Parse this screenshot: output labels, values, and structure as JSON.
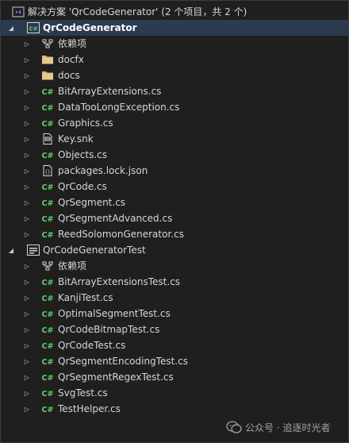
{
  "solution": {
    "label": "解决方案 'QrCodeGenerator' (2 个项目，共 2 个)"
  },
  "projects": [
    {
      "label": "QrCodeGenerator",
      "items": [
        {
          "label": "依赖项",
          "icon": "dependencies-icon"
        },
        {
          "label": "docfx",
          "icon": "folder-icon"
        },
        {
          "label": "docs",
          "icon": "folder-icon"
        },
        {
          "label": "BitArrayExtensions.cs",
          "icon": "csharp-file-icon"
        },
        {
          "label": "DataTooLongException.cs",
          "icon": "csharp-file-icon"
        },
        {
          "label": "Graphics.cs",
          "icon": "csharp-file-icon"
        },
        {
          "label": "Key.snk",
          "icon": "key-file-icon"
        },
        {
          "label": "Objects.cs",
          "icon": "csharp-file-icon"
        },
        {
          "label": "packages.lock.json",
          "icon": "json-file-icon"
        },
        {
          "label": "QrCode.cs",
          "icon": "csharp-file-icon"
        },
        {
          "label": "QrSegment.cs",
          "icon": "csharp-file-icon"
        },
        {
          "label": "QrSegmentAdvanced.cs",
          "icon": "csharp-file-icon"
        },
        {
          "label": "ReedSolomonGenerator.cs",
          "icon": "csharp-file-icon"
        }
      ]
    },
    {
      "label": "QrCodeGeneratorTest",
      "items": [
        {
          "label": "依赖项",
          "icon": "dependencies-icon"
        },
        {
          "label": "BitArrayExtensionsTest.cs",
          "icon": "csharp-file-icon"
        },
        {
          "label": "KanjiTest.cs",
          "icon": "csharp-file-icon"
        },
        {
          "label": "OptimalSegmentTest.cs",
          "icon": "csharp-file-icon"
        },
        {
          "label": "QrCodeBitmapTest.cs",
          "icon": "csharp-file-icon"
        },
        {
          "label": "QrCodeTest.cs",
          "icon": "csharp-file-icon"
        },
        {
          "label": "QrSegmentEncodingTest.cs",
          "icon": "csharp-file-icon"
        },
        {
          "label": "QrSegmentRegexTest.cs",
          "icon": "csharp-file-icon"
        },
        {
          "label": "SvgTest.cs",
          "icon": "csharp-file-icon"
        },
        {
          "label": "TestHelper.cs",
          "icon": "csharp-file-icon"
        }
      ]
    }
  ],
  "watermark": {
    "text": "公众号 · 追逐时光者"
  },
  "colors": {
    "background": "#1f1f1f",
    "selection": "#2b3a4f",
    "csharp_green": "#5fd16a",
    "folder_yellow": "#dcb67a",
    "vs_purple": "#9b6fd6"
  }
}
